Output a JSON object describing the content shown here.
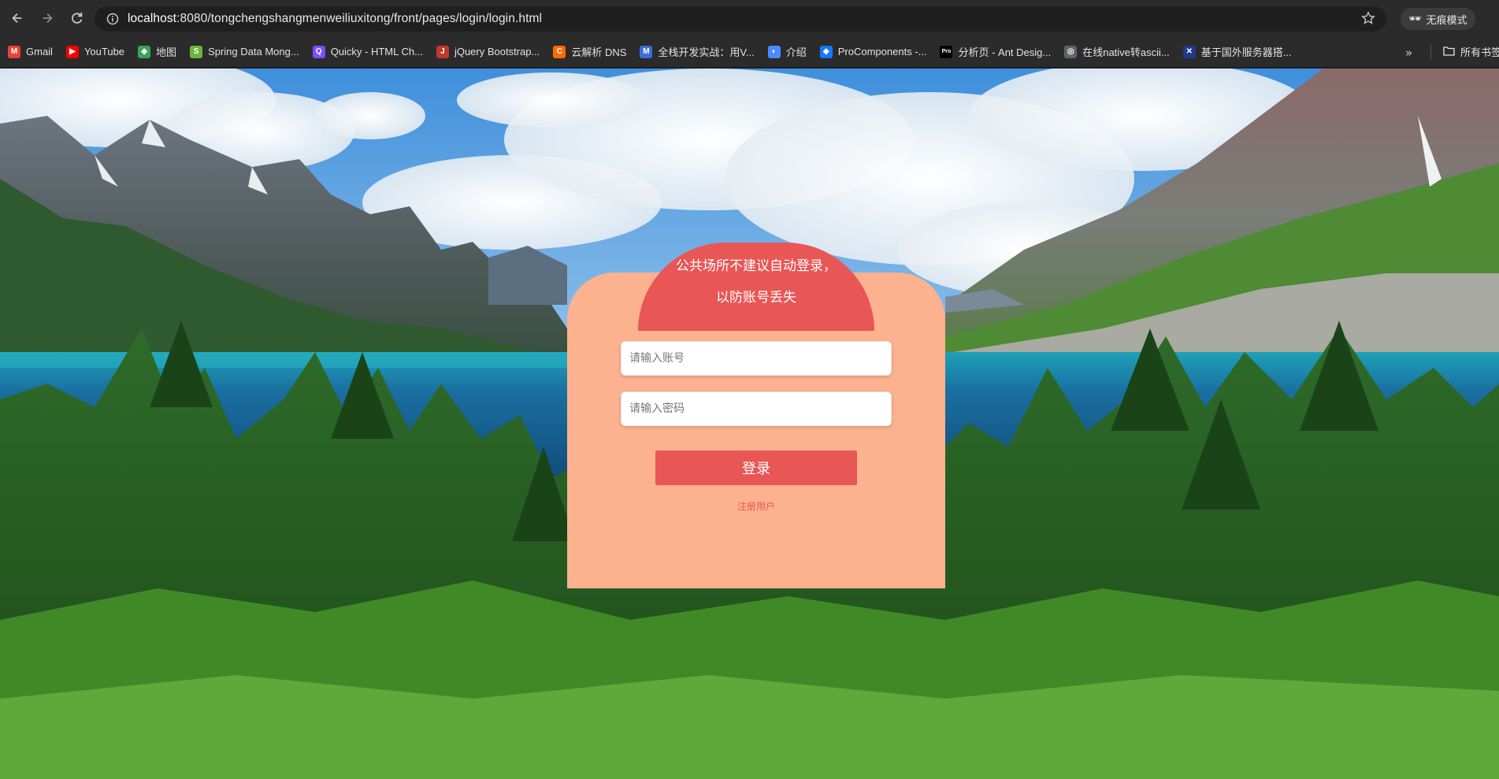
{
  "browser": {
    "url_host": "localhost",
    "url_rest": ":8080/tongchengshangmenweiliuxitong/front/pages/login/login.html",
    "incognito_label": "无痕模式",
    "bookmarks": [
      {
        "label": "Gmail",
        "color": "#ea4335",
        "glyph": "M"
      },
      {
        "label": "YouTube",
        "color": "#ff0000",
        "glyph": "▶"
      },
      {
        "label": "地图",
        "color": "#34a853",
        "glyph": "◆"
      },
      {
        "label": "Spring Data Mong...",
        "color": "#6db33f",
        "glyph": "S"
      },
      {
        "label": "Quicky - HTML Ch...",
        "color": "#7b4dff",
        "glyph": "Q"
      },
      {
        "label": "jQuery Bootstrap...",
        "color": "#c0392b",
        "glyph": "J"
      },
      {
        "label": "云解析 DNS",
        "color": "#ff6a00",
        "glyph": "C"
      },
      {
        "label": "全栈开发实战：用V...",
        "color": "#3b6fd6",
        "glyph": "M"
      },
      {
        "label": "介绍",
        "color": "#4a8cff",
        "glyph": "◐"
      },
      {
        "label": "ProComponents -...",
        "color": "#1677ff",
        "glyph": "◆"
      },
      {
        "label": "分析页 - Ant Desig...",
        "color": "#000000",
        "glyph": "Pro"
      },
      {
        "label": "在线native转ascii...",
        "color": "#5f6368",
        "glyph": "◎"
      },
      {
        "label": "基于国外服务器搭...",
        "color": "#1e3a8a",
        "glyph": "✕"
      }
    ],
    "all_bookmarks_label": "所有书签"
  },
  "login": {
    "notice": "公共场所不建议自动登录，以防账号丢失",
    "account_placeholder": "请输入账号",
    "password_placeholder": "请输入密码",
    "login_label": "登录",
    "register_label": "注册用户"
  },
  "colors": {
    "card_bg": "#fcb28e",
    "accent": "#e85656"
  }
}
